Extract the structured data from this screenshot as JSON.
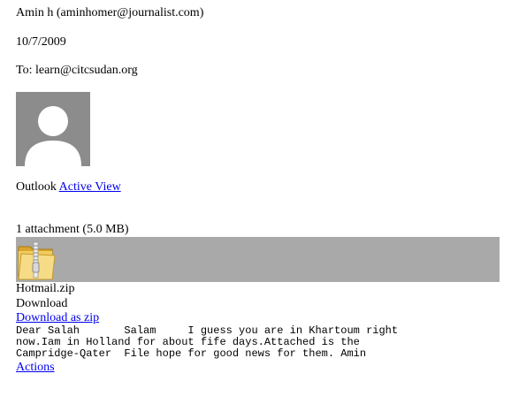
{
  "header": {
    "sender": "Amin h (aminhomer@journalist.com)",
    "date": "10/7/2009",
    "to": "To: learn@citcsudan.org"
  },
  "avatar": {
    "icon": "person-silhouette-icon",
    "background": "#8c8c8c"
  },
  "outlook": {
    "prefix": "Outlook",
    "link": "Active View"
  },
  "attachments": {
    "count_label": "1 attachment (5.0 MB)",
    "bar_color": "#a9a9a9",
    "icon": "zip-folder-icon",
    "file_name": "Hotmail.zip",
    "download_label": "Download",
    "download_zip_label": "Download as zip"
  },
  "message": {
    "body": "Dear Salah       Salam     I guess you are in Khartoum right\nnow.Iam in Holland for about fife days.Attached is the\nCampridge-Qater  File hope for good news for them. Amin"
  },
  "footer": {
    "actions_label": "Actions"
  },
  "colors": {
    "link": "#0000ee"
  }
}
